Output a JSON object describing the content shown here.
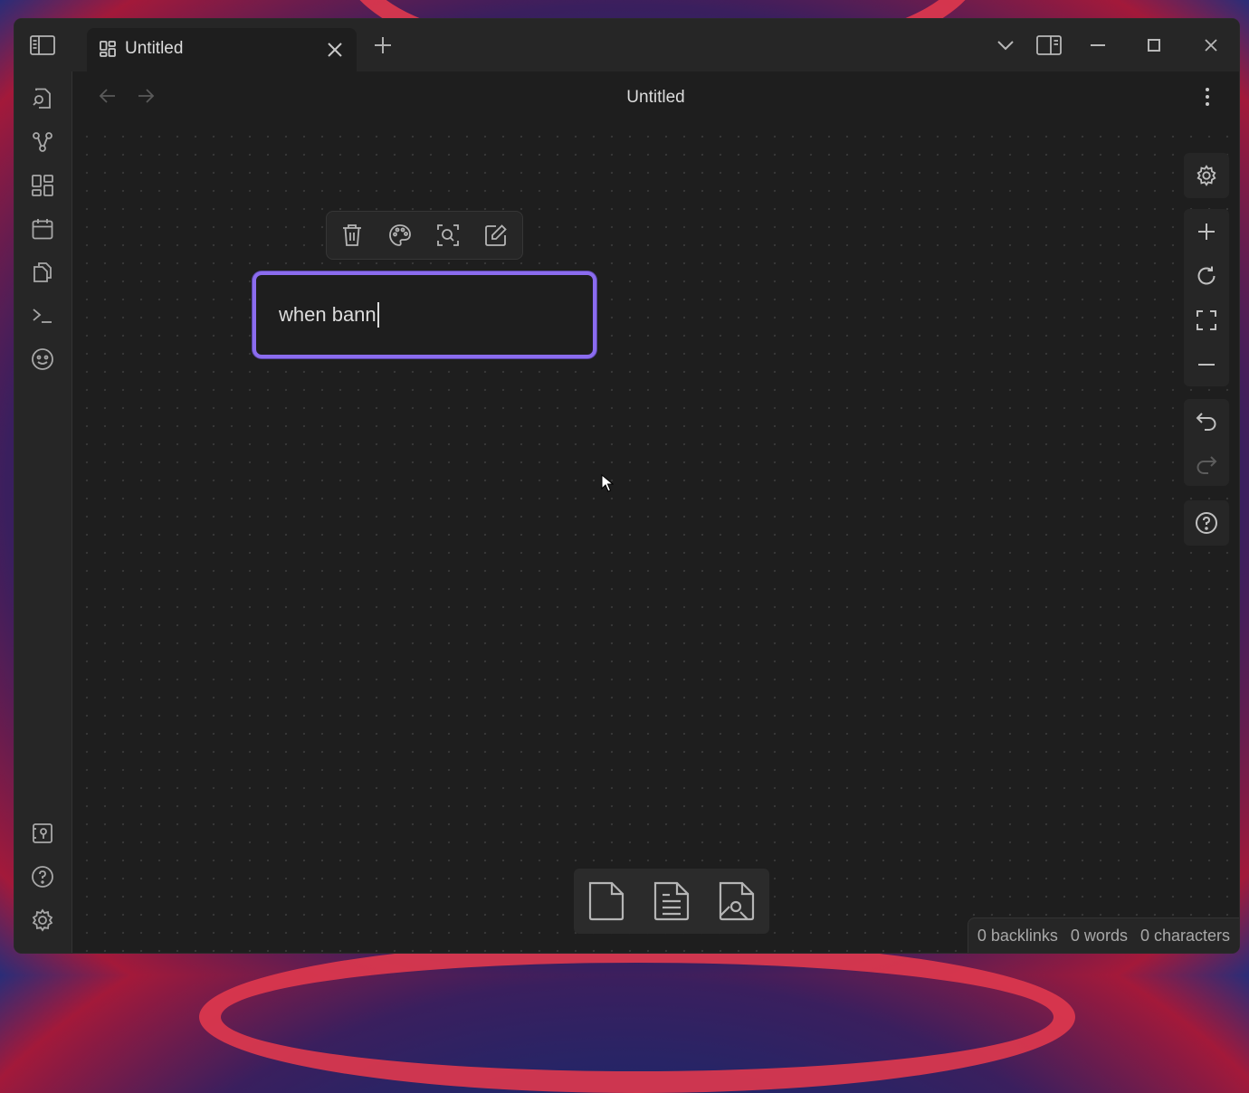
{
  "app": {
    "tab": {
      "title": "Untitled",
      "icon": "canvas-icon"
    },
    "view_title": "Untitled"
  },
  "canvas": {
    "text_node": {
      "text": "when bann"
    },
    "node_toolbar": [
      "trash-icon",
      "palette-icon",
      "zoom-to-selection-icon",
      "edit-icon"
    ],
    "controls": {
      "top": [
        "settings-icon"
      ],
      "zoom": [
        "zoom-in-icon",
        "reset-zoom-icon",
        "zoom-to-fit-icon",
        "zoom-out-icon"
      ],
      "history": [
        "undo-icon",
        "redo-icon"
      ],
      "help": [
        "help-icon"
      ]
    },
    "card_tray": [
      "new-card-icon",
      "add-note-icon",
      "add-media-icon"
    ]
  },
  "ribbon": {
    "top": [
      "quick-switcher-icon",
      "graph-view-icon",
      "canvas-icon",
      "daily-notes-icon",
      "templates-icon",
      "command-palette-icon",
      "plugin-icon"
    ],
    "bottom": [
      "vault-switcher-icon",
      "help-icon",
      "settings-icon"
    ]
  },
  "status": {
    "backlinks": "0 backlinks",
    "words": "0 words",
    "characters": "0 characters"
  },
  "colors": {
    "accent": "#8b6cef",
    "background": "#1e1e1e"
  }
}
